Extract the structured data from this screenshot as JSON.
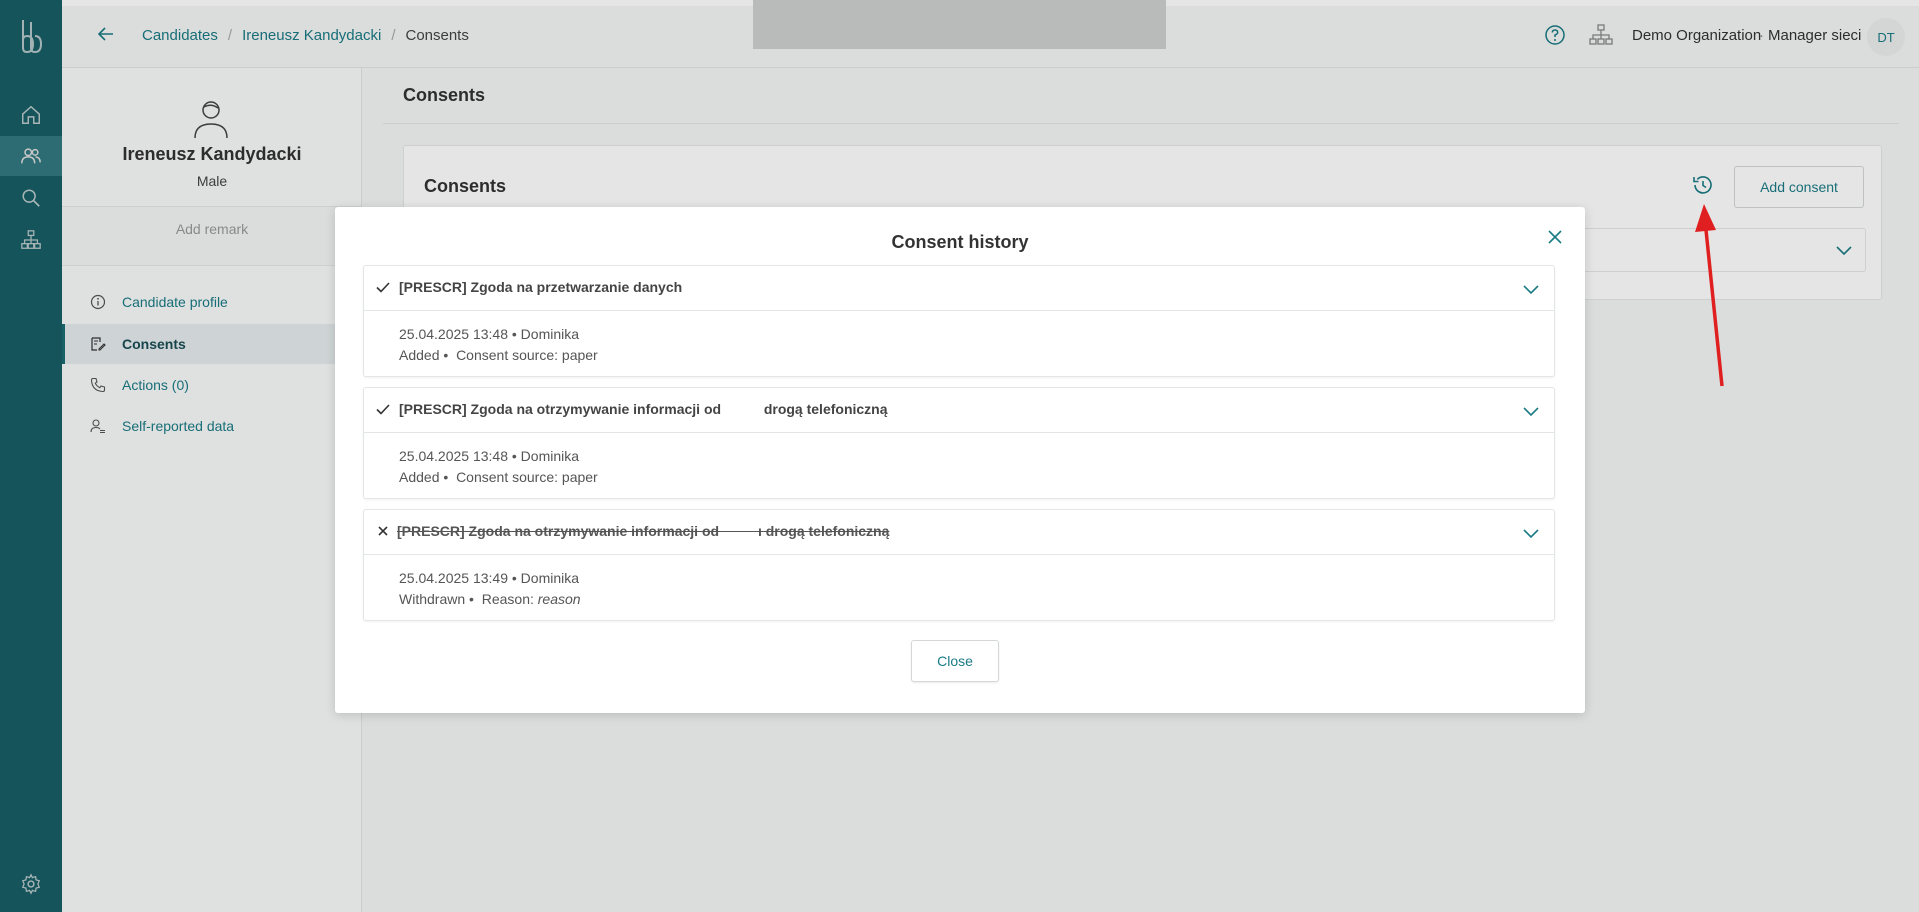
{
  "nav": {
    "items": [
      {
        "name": "home",
        "icon": "home-icon"
      },
      {
        "name": "candidates",
        "icon": "users-icon",
        "active": true
      },
      {
        "name": "search",
        "icon": "search-icon"
      },
      {
        "name": "organization",
        "icon": "org-tree-icon"
      }
    ],
    "settings_icon": "gear-icon"
  },
  "header": {
    "breadcrumb": {
      "candidates": "Candidates",
      "sep": "/",
      "candidate": "Ireneusz Kandydacki",
      "current": "Consents"
    },
    "org_name": "Demo Organization",
    "role_sep": "·",
    "role": "Manager sieci",
    "avatar_initials": "DT"
  },
  "profile": {
    "name": "Ireneusz Kandydacki",
    "gender": "Male",
    "add_remark": "Add remark",
    "menu": [
      {
        "label": "Candidate profile",
        "icon": "info-icon"
      },
      {
        "label": "Consents",
        "icon": "consent-edit-icon",
        "active": true
      },
      {
        "label": "Actions (0)",
        "icon": "phone-icon"
      },
      {
        "label": "Self-reported data",
        "icon": "user-data-icon"
      }
    ]
  },
  "main": {
    "title": "Consents",
    "card": {
      "title": "Consents",
      "add_consent": "Add consent"
    }
  },
  "modal": {
    "title": "Consent history",
    "close_label": "Close",
    "entries": [
      {
        "status": "added",
        "title": "[PRESCR] Zgoda na przetwarzanie danych",
        "meta": "25.04.2025 13:48 • Dominika",
        "action": "Added",
        "detail_label": "Consent source:",
        "detail_value": "paper"
      },
      {
        "status": "added",
        "title": "[PRESCR] Zgoda na otrzymywanie informacji od           drogą telefoniczną",
        "meta": "25.04.2025 13:48 • Dominika",
        "action": "Added",
        "detail_label": "Consent source:",
        "detail_value": "paper"
      },
      {
        "status": "withdrawn",
        "title": "[PRESCR] Zgoda na otrzymywanie informacji od          ı drogą telefoniczną",
        "meta": "25.04.2025 13:49 • Dominika",
        "action": "Withdrawn",
        "detail_label": "Reason:",
        "detail_value": "reason"
      }
    ]
  },
  "colors": {
    "rail": "#1a6b73",
    "accent": "#1a7b85",
    "annotation_arrow": "#e02020"
  }
}
